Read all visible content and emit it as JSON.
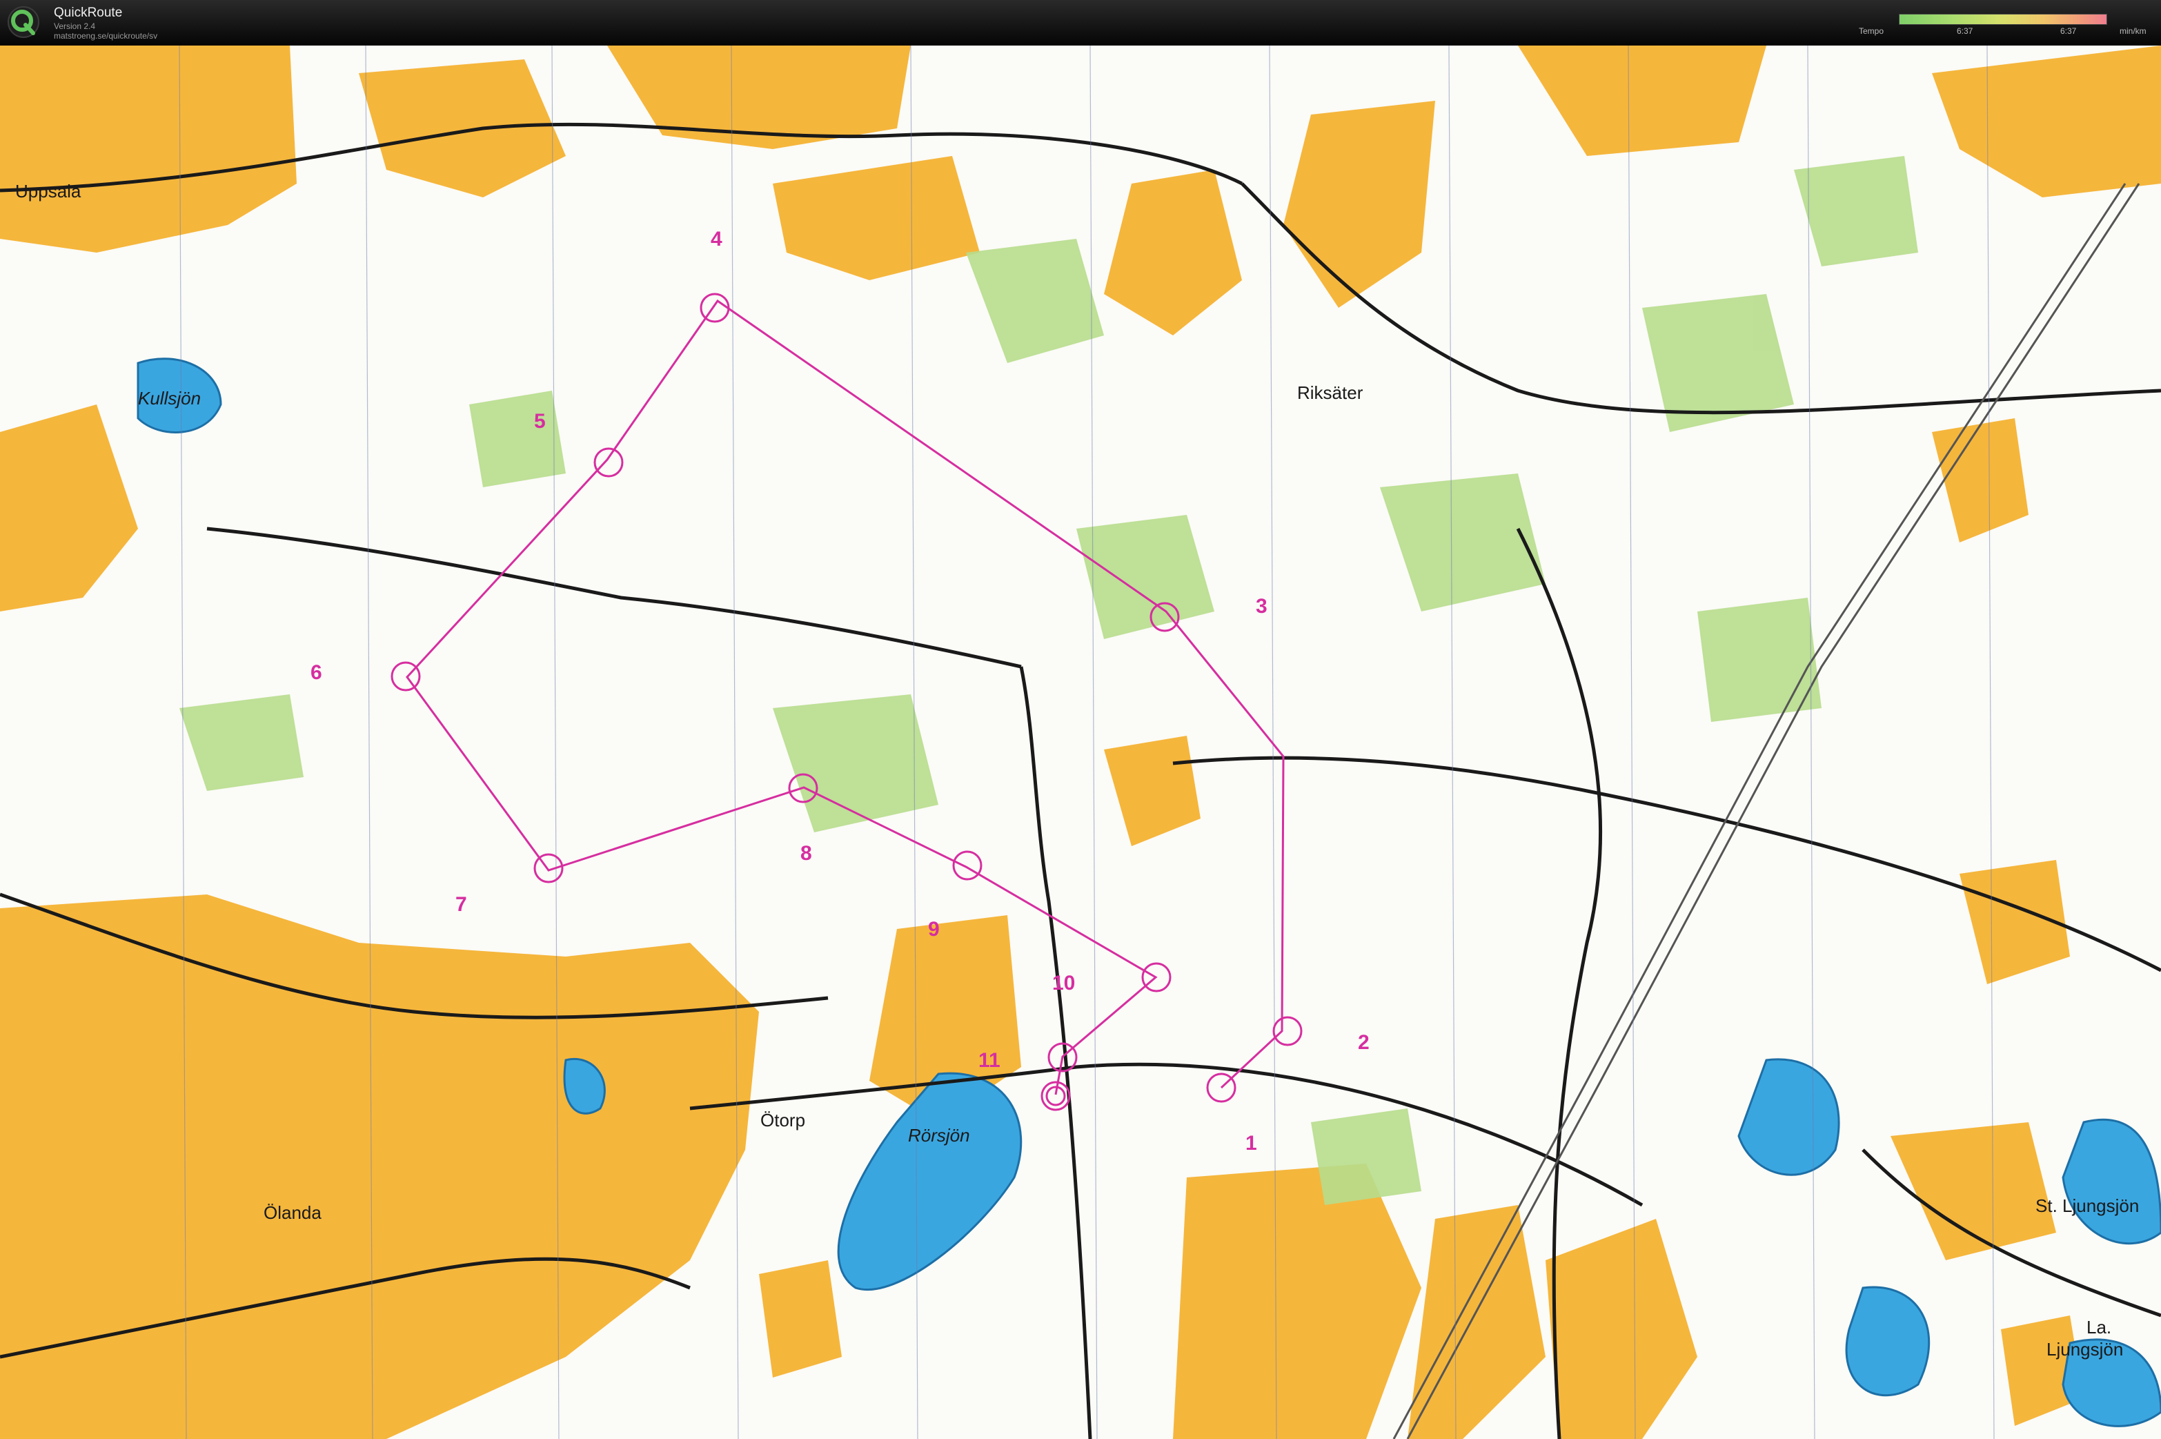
{
  "app": {
    "title": "QuickRoute",
    "version": "Version 2.4",
    "url": "matstroeng.se/quickroute/sv"
  },
  "tempo": {
    "label": "Tempo",
    "tick_left": "6:37",
    "tick_right": "6:37",
    "unit": "min/km"
  },
  "map": {
    "place_names": {
      "uppsala": "Uppsala",
      "kullsjon": "Kullsjön",
      "riksater": "Riksäter",
      "otorp": "Ötorp",
      "olanda": "Ölanda",
      "rorsjon": "Rörsjön",
      "st_ljungsjon": "St. Ljungsjön",
      "la": "La.",
      "ljungsjon": "Ljungsjön"
    },
    "controls": {
      "c1": "1",
      "c2": "2",
      "c3": "3",
      "c4": "4",
      "c5": "5",
      "c6": "6",
      "c7": "7",
      "c8": "8",
      "c9": "9",
      "c10": "10",
      "c11": "11"
    },
    "colors": {
      "open_land": "#f6b73a",
      "forest": "#ffffff",
      "green": "#b6dc8a",
      "water": "#3aa6e0",
      "course": "#d62ea0",
      "road": "#1a1a1a"
    }
  }
}
